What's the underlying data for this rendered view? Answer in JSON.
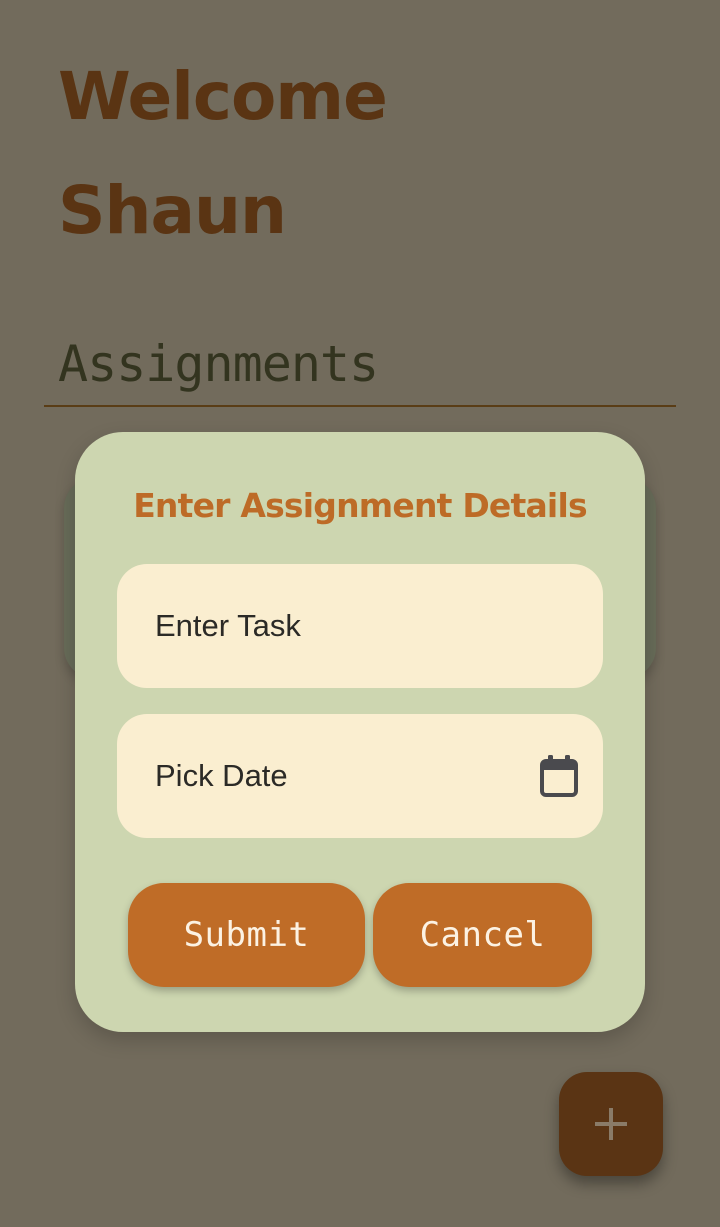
{
  "header": {
    "welcome_line1": "Welcome",
    "welcome_line2": "Shaun"
  },
  "section": {
    "title": "Assignments"
  },
  "dialog": {
    "title": "Enter Assignment Details",
    "task_placeholder": "Enter Task",
    "date_placeholder": "Pick Date",
    "date_icon": "calendar-icon",
    "submit_label": "Submit",
    "cancel_label": "Cancel"
  },
  "fab": {
    "icon": "plus-icon"
  },
  "colors": {
    "background": "#726b5c",
    "dialog_background": "#cdd6b0",
    "field_background": "#faeed0",
    "accent": "#bf6c27",
    "heading": "#5a3413",
    "fab_background": "#5a3414"
  }
}
